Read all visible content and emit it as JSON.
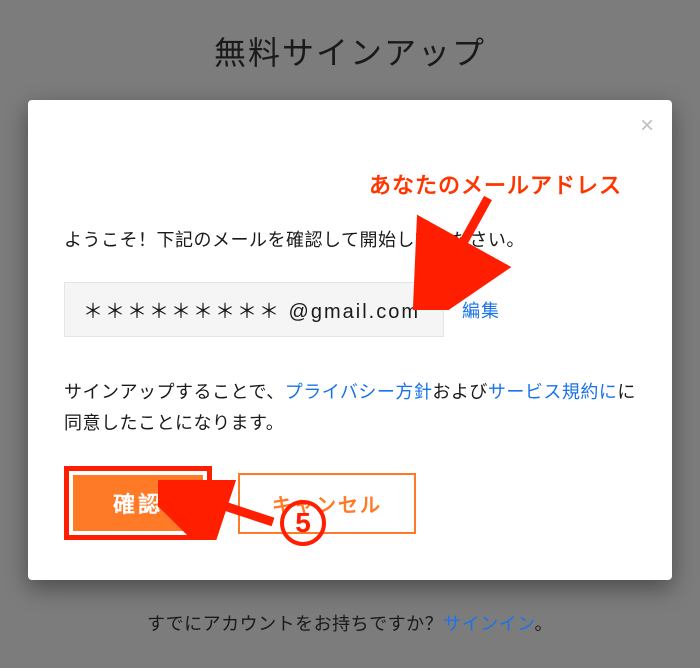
{
  "page": {
    "title": "無料サインアップ"
  },
  "modal": {
    "close_label": "×",
    "annotation_email": "あなたのメールアドレス",
    "welcome": "ようこそ！下記のメールを確認して開始してください。",
    "email_display": "＊＊＊＊＊＊＊＊＊ @gmail.com",
    "edit_label": "編集",
    "terms": {
      "pre": "サインアップすることで、",
      "privacy": "プライバシー方針",
      "mid": "および",
      "tos": "サービス規約に",
      "post": "に同意したことになります。"
    },
    "confirm_label": "確認",
    "cancel_label": "キャンセル",
    "step_number": "5"
  },
  "footer": {
    "pre": "すでにアカウントをお持ちですか？",
    "signin": "サインイン",
    "post": "。"
  }
}
